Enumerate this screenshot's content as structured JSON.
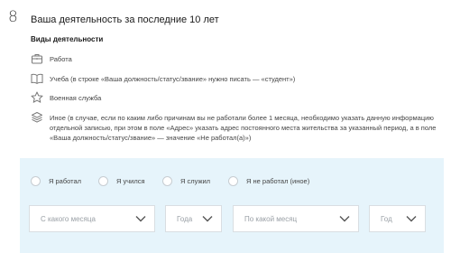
{
  "step": {
    "number": "8",
    "title": "Ваша деятельность за последние 10 лет"
  },
  "activities": {
    "heading": "Виды деятельности",
    "items": [
      {
        "icon": "briefcase-icon",
        "label": "Работа"
      },
      {
        "icon": "book-icon",
        "label": "Учеба (в строке «Ваша должность/статус/звание» нужно писать — «студент»)"
      },
      {
        "icon": "star-icon",
        "label": "Военная служба"
      },
      {
        "icon": "layers-icon",
        "label": "Иное (в случае, если по каким либо причинам вы не работали более 1 месяца, необходимо указать данную информацию отдельной записью, при этом в поле «Адрес» указать адрес постоянного места жительства за указанный период, а в поле «Ваша должность/статус/звание» — значение «Не работал(а)»)"
      }
    ]
  },
  "form": {
    "radios": [
      {
        "label": "Я работал",
        "checked": false
      },
      {
        "label": "Я учился",
        "checked": false
      },
      {
        "label": "Я служил",
        "checked": false
      },
      {
        "label": "Я не работал (иное)",
        "checked": false
      }
    ],
    "selects": {
      "from_month": "С какого месяца",
      "from_year": "Года",
      "to_month": "По какой месяц",
      "to_year": "Год"
    }
  },
  "colors": {
    "panel_bg": "#e6f4fb",
    "icon": "#777777",
    "chevron": "#555555"
  }
}
